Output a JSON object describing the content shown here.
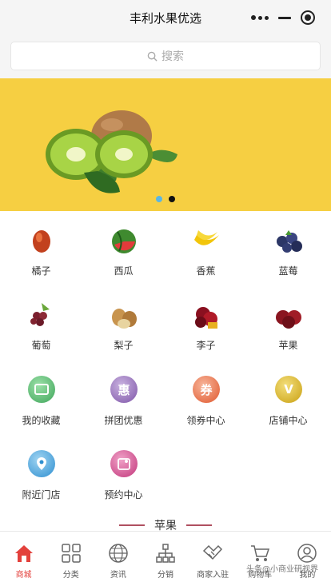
{
  "header": {
    "title": "丰利水果优选"
  },
  "search": {
    "placeholder": "搜索"
  },
  "banner": {
    "dots": 2,
    "active_dot": 1
  },
  "grid": {
    "items": [
      {
        "label": "橘子",
        "icon": "orange-icon"
      },
      {
        "label": "西瓜",
        "icon": "watermelon-icon"
      },
      {
        "label": "香蕉",
        "icon": "banana-icon"
      },
      {
        "label": "蓝莓",
        "icon": "blueberry-icon"
      },
      {
        "label": "葡萄",
        "icon": "grape-icon"
      },
      {
        "label": "梨子",
        "icon": "pear-icon"
      },
      {
        "label": "李子",
        "icon": "plum-icon"
      },
      {
        "label": "苹果",
        "icon": "apple-icon"
      },
      {
        "label": "我的收藏",
        "icon": "favorites-icon"
      },
      {
        "label": "拼团优惠",
        "icon": "group-buy-icon"
      },
      {
        "label": "领券中心",
        "icon": "coupon-icon"
      },
      {
        "label": "店铺中心",
        "icon": "store-icon"
      },
      {
        "label": "附近门店",
        "icon": "location-icon"
      },
      {
        "label": "预约中心",
        "icon": "reservation-icon"
      }
    ]
  },
  "section": {
    "title": "苹果"
  },
  "tabbar": {
    "tabs": [
      {
        "label": "商城",
        "icon": "home-icon",
        "active": true
      },
      {
        "label": "分类",
        "icon": "category-icon"
      },
      {
        "label": "资讯",
        "icon": "globe-icon"
      },
      {
        "label": "分销",
        "icon": "distribution-icon"
      },
      {
        "label": "商家入驻",
        "icon": "handshake-icon"
      },
      {
        "label": "购物车",
        "icon": "cart-icon"
      },
      {
        "label": "我的",
        "icon": "user-icon"
      }
    ]
  },
  "watermark": "头条@小商业研视界",
  "colors": {
    "banner_bg": "#f6cf42",
    "active_tab": "#e3413c",
    "accent_line": "#b05060"
  }
}
